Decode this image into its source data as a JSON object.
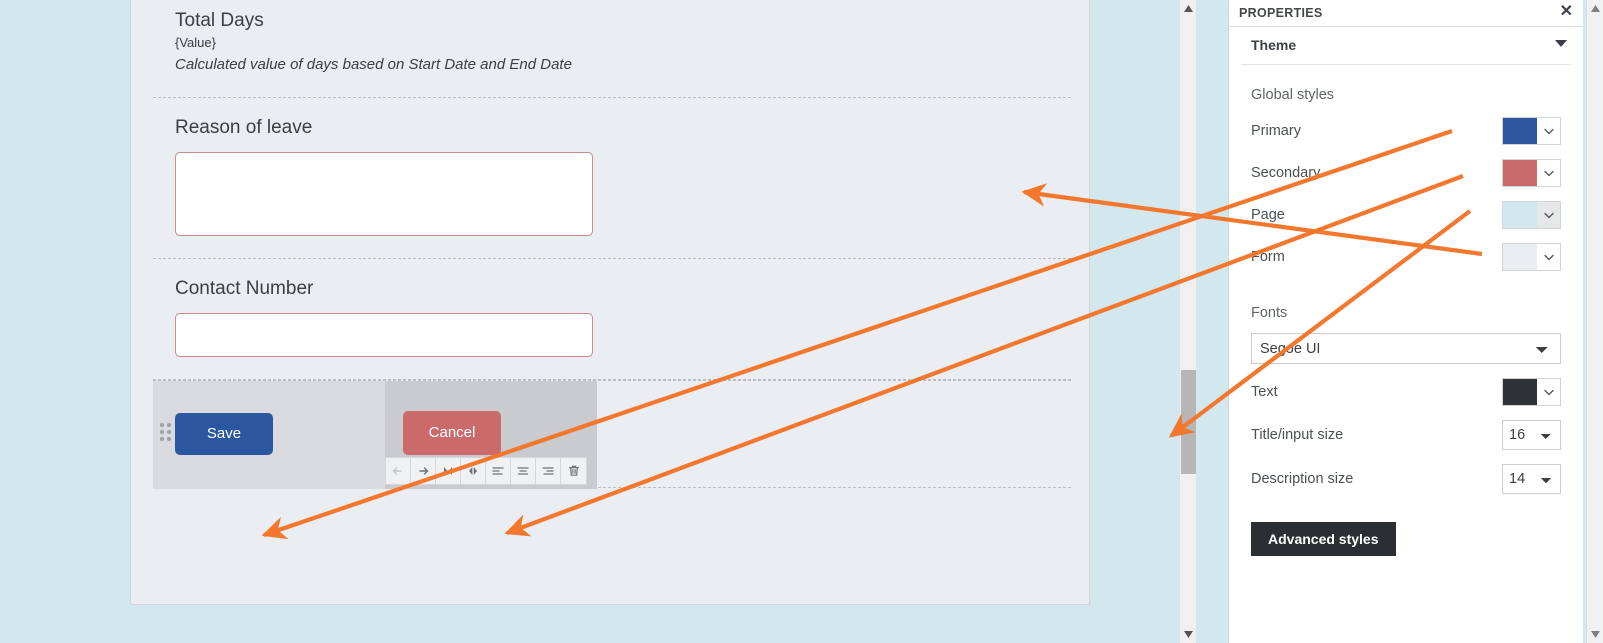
{
  "form": {
    "fields": [
      {
        "title": "Total Days",
        "token": "{Value}",
        "description": "Calculated value of days based on Start Date and End Date"
      },
      {
        "title": "Reason of leave",
        "value": "",
        "placeholder": ""
      },
      {
        "title": "Contact Number",
        "value": "",
        "placeholder": ""
      }
    ],
    "buttons": {
      "save_label": "Save",
      "cancel_label": "Cancel"
    },
    "element_toolbar": [
      {
        "name": "move-left-icon",
        "glyph": "←",
        "disabled": true
      },
      {
        "name": "move-right-icon",
        "glyph": "→",
        "disabled": false
      },
      {
        "name": "collapse-width-icon",
        "glyph": "▶◀",
        "disabled": false
      },
      {
        "name": "expand-width-icon",
        "glyph": "◀▶",
        "disabled": false
      },
      {
        "name": "align-left-icon",
        "glyph": "",
        "disabled": false
      },
      {
        "name": "align-center-icon",
        "glyph": "",
        "disabled": false
      },
      {
        "name": "align-right-icon",
        "glyph": "",
        "disabled": false
      },
      {
        "name": "delete-icon",
        "glyph": "",
        "disabled": false
      }
    ]
  },
  "properties": {
    "header_title": "PROPERTIES",
    "close_label": "✕",
    "section_title": "Theme",
    "global_styles_label": "Global styles",
    "color_rows": [
      {
        "label": "Primary",
        "color": "#2b56a0"
      },
      {
        "label": "Secondary",
        "color": "#cb6a6a"
      },
      {
        "label": "Page",
        "color": "#d3e7ef"
      },
      {
        "label": "Form",
        "color": "#eaedf1"
      }
    ],
    "fonts_label": "Fonts",
    "font_family": "Segoe UI",
    "text_row": {
      "label": "Text",
      "color": "#2f3337"
    },
    "size_rows": [
      {
        "label": "Title/input size",
        "value": "16"
      },
      {
        "label": "Description size",
        "value": "14"
      }
    ],
    "advanced_button": "Advanced styles"
  },
  "colors": {
    "page_background": "#d3e7ef",
    "form_background": "#eaedf1",
    "primary": "#2b56a0",
    "secondary": "#cb6a6a",
    "annotation": "#f4772e"
  }
}
